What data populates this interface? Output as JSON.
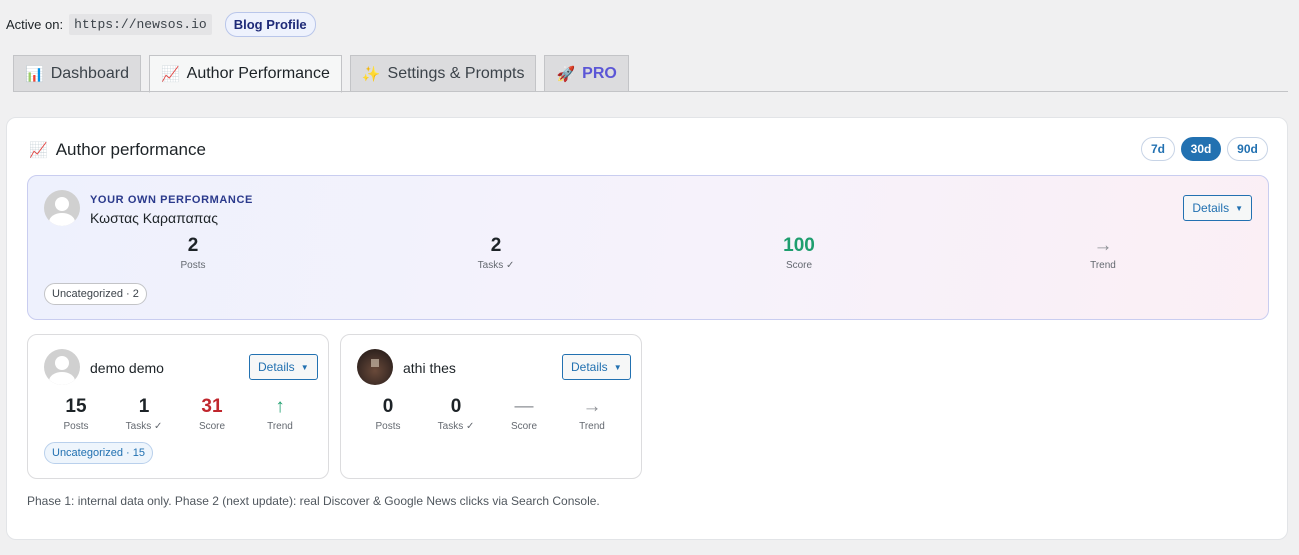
{
  "topbar": {
    "active_label": "Active on:",
    "url": "https://newsos.io",
    "blog_profile": "Blog Profile"
  },
  "tabs": [
    {
      "icon": "📊",
      "label": "Dashboard"
    },
    {
      "icon": "📈",
      "label": "Author Performance"
    },
    {
      "icon": "✨",
      "label": "Settings & Prompts"
    },
    {
      "icon": "🚀",
      "label": "PRO"
    }
  ],
  "card": {
    "icon": "📈",
    "title": "Author performance",
    "ranges": [
      "7d",
      "30d",
      "90d"
    ],
    "selected_range": "30d"
  },
  "own": {
    "kicker": "YOUR OWN PERFORMANCE",
    "name": "Κωστας Καραπαπας",
    "details": "Details",
    "caret": "▼",
    "stats": [
      {
        "value": "2",
        "label": "Posts"
      },
      {
        "value": "2",
        "label": "Tasks ✓"
      },
      {
        "value": "100",
        "label": "Score"
      },
      {
        "value": "→",
        "label": "Trend"
      }
    ],
    "chip": "Uncategorized · 2"
  },
  "authors": [
    {
      "name": "demo demo",
      "details": "Details",
      "caret": "▼",
      "stats": [
        {
          "value": "15",
          "label": "Posts"
        },
        {
          "value": "1",
          "label": "Tasks ✓"
        },
        {
          "value": "31",
          "label": "Score"
        },
        {
          "value": "↑",
          "label": "Trend"
        }
      ],
      "chip": "Uncategorized · 15"
    },
    {
      "name": "athi thes",
      "details": "Details",
      "caret": "▼",
      "stats": [
        {
          "value": "0",
          "label": "Posts"
        },
        {
          "value": "0",
          "label": "Tasks ✓"
        },
        {
          "value": "—",
          "label": "Score"
        },
        {
          "value": "→",
          "label": "Trend"
        }
      ]
    }
  ],
  "footnote": "Phase 1: internal data only. Phase 2 (next update): real Discover & Google News clicks via Search Console."
}
